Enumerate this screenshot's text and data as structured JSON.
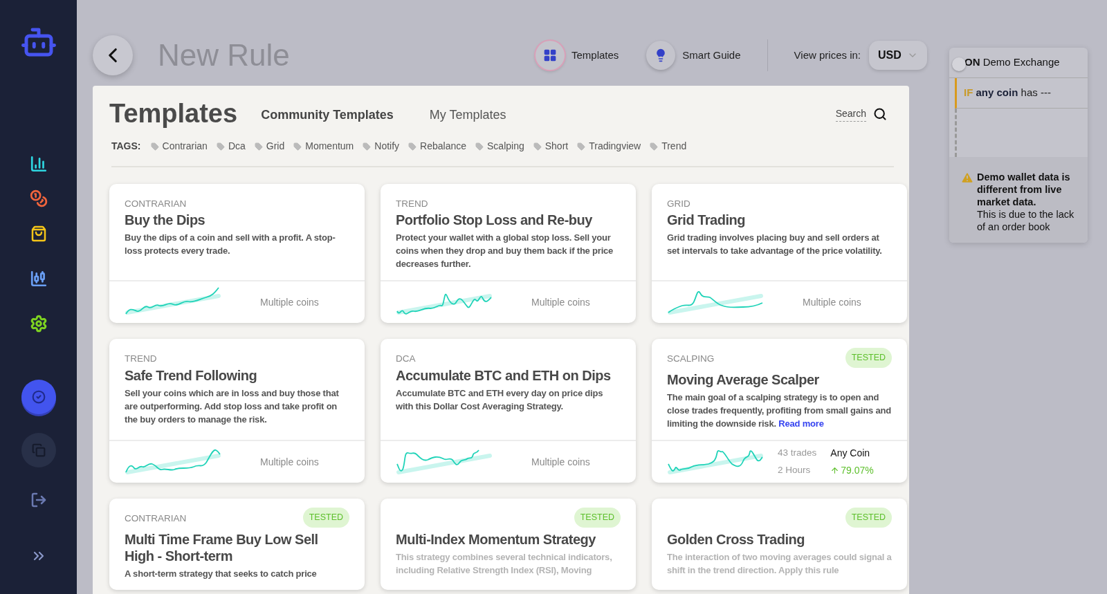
{
  "sidebar": {
    "items": [
      {
        "kind": "check",
        "selected": true
      },
      {
        "kind": "copy",
        "selected": false
      }
    ]
  },
  "header": {
    "title": "New Rule",
    "nav": [
      {
        "kind": "templates",
        "label": "Templates",
        "selected": true
      },
      {
        "kind": "guide",
        "label": "Smart Guide",
        "selected": false
      }
    ],
    "currency_label": "View prices in:",
    "currency": "USD"
  },
  "templates": {
    "title": "Templates",
    "tabs": [
      {
        "label": "Community Templates",
        "selected": true
      },
      {
        "label": "My Templates",
        "selected": false
      }
    ],
    "search": "Search",
    "tags_label": "TAGS:",
    "tags": [
      "Contrarian",
      "Dca",
      "Grid",
      "Momentum",
      "Notify",
      "Rebalance",
      "Scalping",
      "Short",
      "Tradingview",
      "Trend"
    ],
    "cards": [
      {
        "category": "CONTRARIAN",
        "title": "Buy the Dips",
        "description": "Buy the dips of a coin and sell with a profit. A stop-loss protects every trade.",
        "blurred": false,
        "footer": {
          "kind": "coins",
          "text": "Multiple coins"
        }
      },
      {
        "category": "TREND",
        "title": "Portfolio Stop Loss and Re-buy",
        "description": "Protect your wallet with a global stop loss. Sell your coins when they drop and buy them back if the price decreases further.",
        "blurred": false,
        "footer": {
          "kind": "coins",
          "text": "Multiple coins"
        }
      },
      {
        "category": "GRID",
        "title": "Grid Trading",
        "description": "Grid trading involves placing buy and sell orders at set intervals to take advantage of the price volatility.",
        "blurred": false,
        "footer": {
          "kind": "coins",
          "text": "Multiple coins"
        }
      },
      {
        "category": "TREND",
        "title": "Safe Trend Following",
        "description": "Sell your coins which are in loss and buy those that are outperforming. Add stop loss and take profit on the buy orders to manage the risk.",
        "blurred": false,
        "footer": {
          "kind": "coins",
          "text": "Multiple coins"
        }
      },
      {
        "category": "DCA",
        "title": "Accumulate BTC and ETH on Dips",
        "description": "Accumulate BTC and ETH every day on price dips with this Dollar Cost Averaging Strategy.",
        "blurred": false,
        "footer": {
          "kind": "coins",
          "text": "Multiple coins"
        }
      },
      {
        "category": "SCALPING",
        "badge": "TESTED",
        "title": "Moving Average Scalper",
        "description": "The main goal of a scalping strategy is to open and close trades frequently, profiting from small gains and limiting the downside risk.",
        "link": "Read more",
        "blurred": false,
        "footer": {
          "kind": "stats",
          "trades": "43 trades",
          "duration": "2 Hours",
          "coin": "Any Coin",
          "change": "79.07%"
        }
      },
      {
        "category": "CONTRARIAN",
        "badge": "TESTED",
        "title": "Multi Time Frame Buy Low Sell High - Short-term",
        "description": "A short-term strategy that seeks to catch price",
        "blurred": false
      },
      {
        "badge": "TESTED",
        "title": "Multi-Index Momentum Strategy",
        "description": "This strategy combines several technical indicators, including Relative Strength Index (RSI), Moving",
        "blurred": true
      },
      {
        "badge": "TESTED",
        "title": "Golden Cross Trading",
        "description": "The interaction of two moving averages could signal a shift in the trend direction. Apply this rule",
        "blurred": true
      }
    ]
  },
  "rule": {
    "on": {
      "keyword": "ON",
      "text": "Demo Exchange"
    },
    "if": {
      "keyword": "IF",
      "subject": "any coin",
      "text": "has ---"
    },
    "warning": {
      "title": "Demo wallet data is different from live market data.",
      "body": "This is due to the lack of an order book"
    }
  }
}
